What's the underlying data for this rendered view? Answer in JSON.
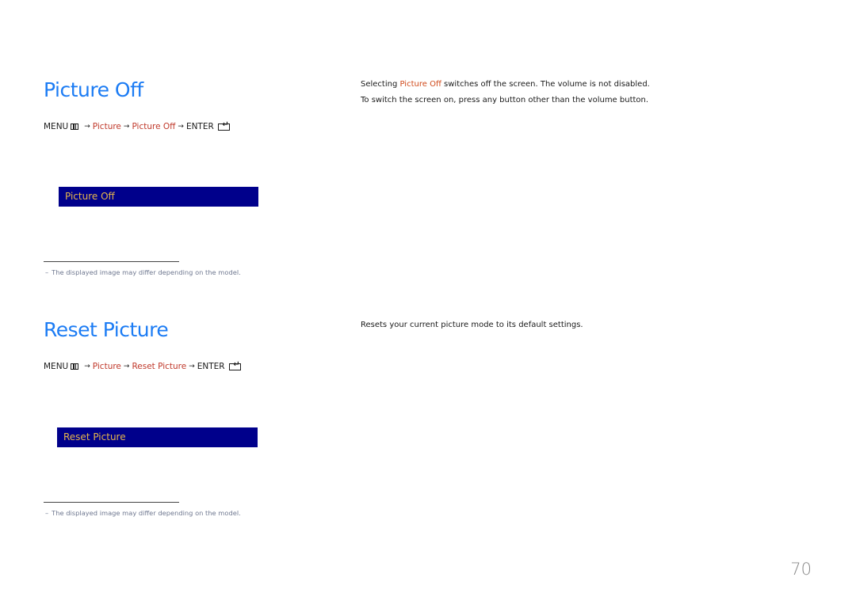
{
  "sections": [
    {
      "title": "Picture Off",
      "menu_path": {
        "menu": "MENU",
        "arrow": "→",
        "step1": "Picture",
        "step2": "Picture Off",
        "enter": "ENTER"
      },
      "osd_label": "Picture Off",
      "note_dash": "–",
      "note": "The displayed image may differ depending on the model.",
      "description": {
        "line1_pre": "Selecting ",
        "line1_highlight": "Picture Off",
        "line1_post": " switches off the screen. The volume is not disabled.",
        "line2": "To switch the screen on, press any button other than the volume button."
      }
    },
    {
      "title": "Reset Picture",
      "menu_path": {
        "menu": "MENU",
        "arrow": "→",
        "step1": "Picture",
        "step2": "Reset Picture",
        "enter": "ENTER"
      },
      "osd_label": "Reset Picture",
      "note_dash": "–",
      "note": "The displayed image may differ depending on the model.",
      "description": {
        "line1": "Resets your current picture mode to its default settings."
      }
    }
  ],
  "page_number": "70",
  "colors": {
    "title": "#1c7cf4",
    "highlight": "#c0392b",
    "osd_background": "#00008b",
    "osd_text": "#e6b64c",
    "note_text": "#6f7890"
  }
}
